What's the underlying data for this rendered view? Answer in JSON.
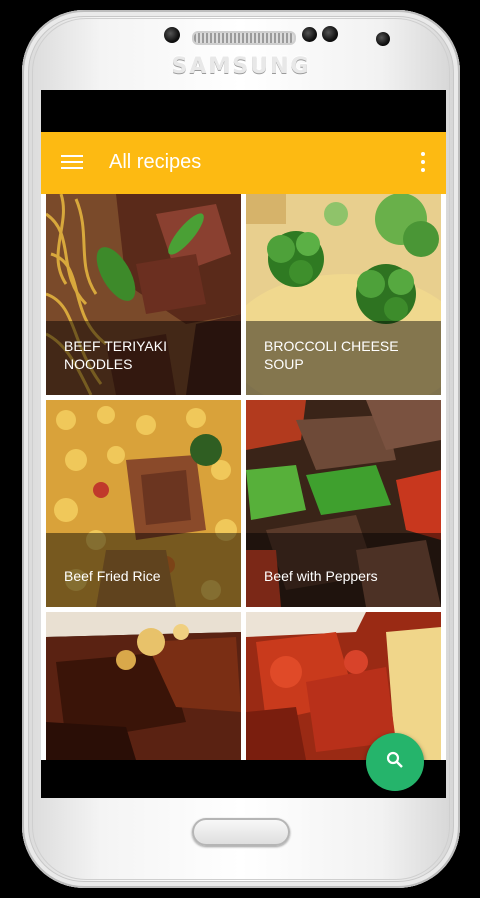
{
  "device": {
    "brand": "SAMSUNG"
  },
  "appbar": {
    "title": "All recipes",
    "color": "#fdba12"
  },
  "recipes": [
    {
      "name": "BEEF TERIYAKI NOODLES"
    },
    {
      "name": "BROCCOLI CHEESE SOUP"
    },
    {
      "name": "Beef Fried Rice"
    },
    {
      "name": "Beef with Peppers"
    },
    {
      "name": ""
    },
    {
      "name": ""
    }
  ],
  "fab": {
    "icon": "search-icon",
    "color": "#25b46b"
  },
  "icons": {
    "menu": "menu-icon",
    "overflow": "more-vert-icon"
  }
}
